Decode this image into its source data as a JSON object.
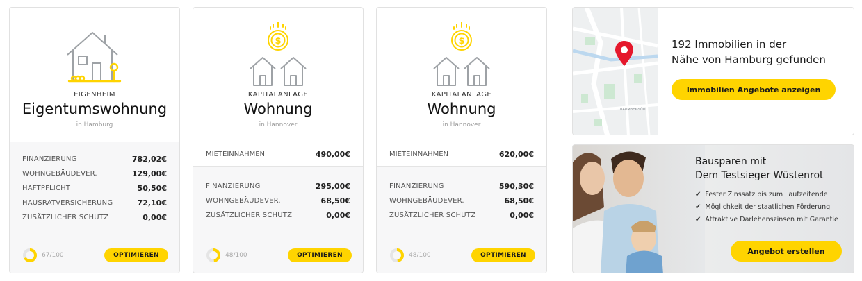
{
  "cards": [
    {
      "category": "EIGENHEIM",
      "type": "Eigentumswohnung",
      "location": "in Hamburg",
      "costs": [
        {
          "label": "FINANZIERUNG",
          "value": "782,02€"
        },
        {
          "label": "WOHNGEBÄUDEVER.",
          "value": "129,00€"
        },
        {
          "label": "HAFTPFLICHT",
          "value": "50,50€"
        },
        {
          "label": "HAUSRATVERSICHERUNG",
          "value": "72,10€"
        },
        {
          "label": "ZUSÄTZLICHER SCHUTZ",
          "value": "0,00€"
        }
      ],
      "score_text": "67/100",
      "score": 67,
      "button": "OPTIMIEREN"
    },
    {
      "category": "KAPITALANLAGE",
      "type": "Wohnung",
      "location": "in Hannover",
      "income": {
        "label": "MIETEINNAHMEN",
        "value": "490,00€"
      },
      "costs": [
        {
          "label": "FINANZIERUNG",
          "value": "295,00€"
        },
        {
          "label": "WOHNGEBÄUDEVER.",
          "value": "68,50€"
        },
        {
          "label": "ZUSÄTZLICHER SCHUTZ",
          "value": "0,00€"
        }
      ],
      "score_text": "48/100",
      "score": 48,
      "button": "OPTIMIEREN"
    },
    {
      "category": "KAPITALANLAGE",
      "type": "Wohnung",
      "location": "in Hannover",
      "income": {
        "label": "MIETEINNAHMEN",
        "value": "620,00€"
      },
      "costs": [
        {
          "label": "FINANZIERUNG",
          "value": "590,30€"
        },
        {
          "label": "WOHNGEBÄUDEVER.",
          "value": "68,50€"
        },
        {
          "label": "ZUSÄTZLICHER SCHUTZ",
          "value": "0,00€"
        }
      ],
      "score_text": "48/100",
      "score": 48,
      "button": "OPTIMIEREN"
    }
  ],
  "map": {
    "title_line1": "192 Immobilien in der",
    "title_line2": "Nähe von Hamburg gefunden",
    "button": "Immobilien Angebote anzeigen",
    "street_label": "BARMBEK-SÜD"
  },
  "promo": {
    "title_line1": "Bausparen mit",
    "title_line2": "Dem Testsieger Wüstenrot",
    "features": [
      "Fester Zinssatz bis zum Laufzeitende",
      "Möglichkeit der staatlichen Förderung",
      "Attraktive Darlehenszinsen mit Garantie"
    ],
    "button": "Angebot erstellen"
  },
  "colors": {
    "accent": "#ffd400",
    "icon_gray": "#9ea2a6",
    "pin": "#e5182c"
  }
}
